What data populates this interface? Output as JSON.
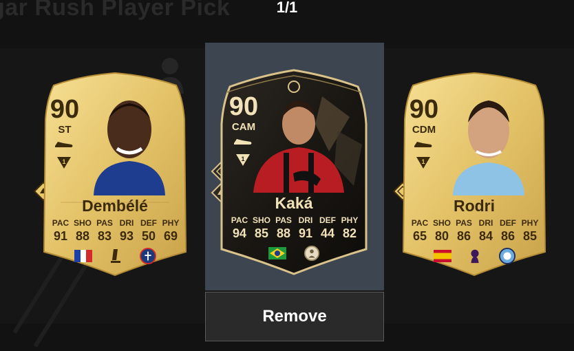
{
  "header": {
    "background_title": "gar Rush Player Pick",
    "counter": "1/1"
  },
  "actions": {
    "remove_label": "Remove"
  },
  "stat_labels": [
    "PAC",
    "SHO",
    "PAS",
    "DRI",
    "DEF",
    "PHY"
  ],
  "cards": [
    {
      "name": "Dembélé",
      "rating": "90",
      "position": "ST",
      "stats": [
        "91",
        "88",
        "83",
        "93",
        "50",
        "69"
      ],
      "nation": "France",
      "league": "Ligue 1",
      "club": "PSG",
      "theme": "gold",
      "accent": "#e7c86a"
    },
    {
      "name": "Kaká",
      "rating": "90",
      "position": "CAM",
      "stats": [
        "94",
        "85",
        "88",
        "91",
        "44",
        "82"
      ],
      "nation": "Brazil",
      "league": "Icons",
      "club": "Icon",
      "theme": "black-gold",
      "accent": "#1c1915"
    },
    {
      "name": "Rodri",
      "rating": "90",
      "position": "CDM",
      "stats": [
        "65",
        "80",
        "86",
        "84",
        "86",
        "85"
      ],
      "nation": "Spain",
      "league": "Premier League",
      "club": "Manchester City",
      "theme": "gold",
      "accent": "#e7c86a"
    }
  ],
  "colors": {
    "background": "#121212",
    "selected_panel": "#3c4550",
    "gold_card": "#e7c86a",
    "gold_text": "#3b2a0c",
    "dark_card": "#1c1915",
    "dark_card_text": "#f2e2b8"
  }
}
